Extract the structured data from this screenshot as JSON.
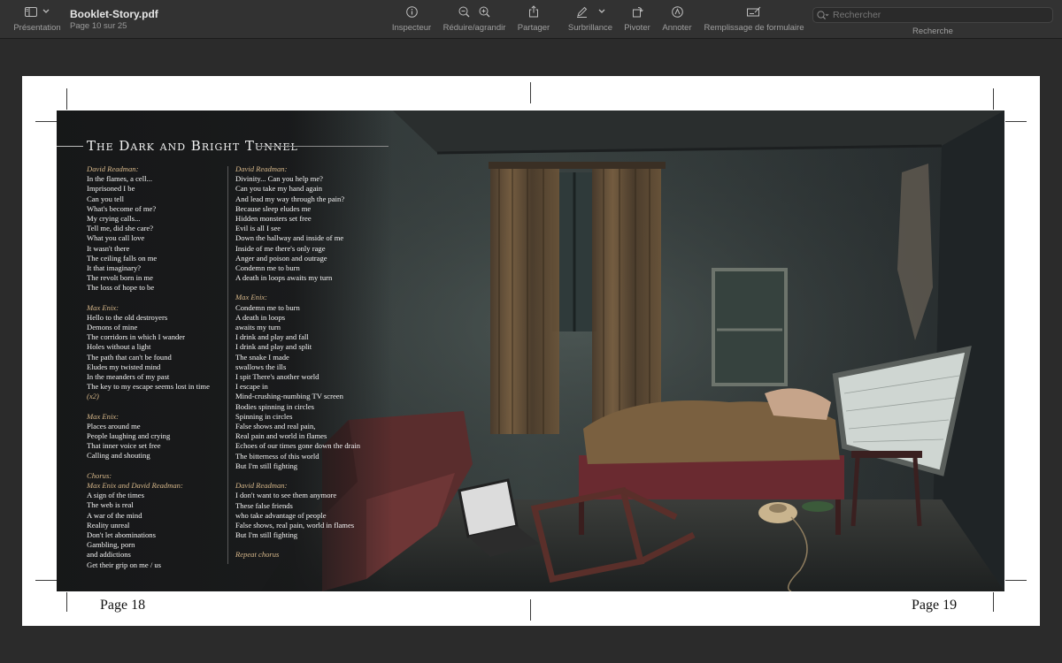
{
  "toolbar": {
    "view_label": "Présentation",
    "doc_title": "Booklet-Story.pdf",
    "doc_subtitle": "Page 10 sur 25",
    "inspector_label": "Inspecteur",
    "zoom_label": "Réduire/agrandir",
    "share_label": "Partager",
    "highlight_label": "Surbrillance",
    "rotate_label": "Pivoter",
    "annotate_label": "Annoter",
    "form_label": "Remplissage de formulaire",
    "search_placeholder": "Rechercher",
    "search_label": "Recherche"
  },
  "colors": {
    "accent_italic": "#d6b78a",
    "toolbar_bg": "#323232",
    "canvas_bg": "#2b2b2b"
  },
  "icons": [
    "sidebar-icon",
    "chevron-down-icon",
    "info-icon",
    "zoom-out-icon",
    "zoom-in-icon",
    "share-icon",
    "highlighter-icon",
    "rotate-icon",
    "annotate-icon",
    "form-fill-icon",
    "search-icon"
  ],
  "page": {
    "song_title": "The Dark and Bright Tunnel",
    "left_page": "Page 18",
    "right_page": "Page 19",
    "col1": [
      {
        "speaker": "David Readman:",
        "lines": [
          "In the flames, a cell...",
          "Imprisoned I be",
          "Can you tell",
          "What's become of me?",
          "My crying calls...",
          "Tell me, did she care?",
          "What you call love",
          "It wasn't there",
          "The ceiling falls on me",
          "It that imaginary?",
          "The revolt born in me",
          "The loss of hope to be"
        ]
      },
      {
        "speaker": "Max Enix:",
        "lines": [
          "Hello to the old destroyers",
          "Demons of mine",
          "The corridors in which I wander",
          "Holes without a light",
          "The path that can't be found",
          "Eludes my twisted mind",
          "In the meanders of my past",
          "The key to my escape seems lost in time"
        ],
        "extra": "(x2)"
      },
      {
        "speaker": "Max Enix:",
        "lines": [
          "Places around me",
          "People laughing and crying",
          "That inner voice set free",
          "Calling and shouting"
        ]
      },
      {
        "speaker": "Chorus:",
        "speaker2": "Max Enix and David Readman:",
        "lines": [
          "A sign of the times",
          "The web is real",
          "A war of the mind",
          "Reality unreal",
          "Don't let abominations",
          "Gambling, porn",
          "and addictions",
          "Get their grip on me / us"
        ]
      }
    ],
    "col2": [
      {
        "speaker": "David Readman:",
        "lines": [
          "Divinity... Can you help me?",
          "Can you take my hand again",
          "And lead my way through the pain?",
          "Because sleep eludes me",
          "Hidden monsters set free",
          "Evil is all I see",
          "Down the hallway and inside of me",
          "Inside of me there's only rage",
          "Anger and poison and outrage",
          "Condemn me to burn",
          "A death in loops awaits my turn"
        ]
      },
      {
        "speaker": "Max Enix:",
        "lines": [
          "Condemn me to burn",
          "A death in loops",
          "awaits my turn",
          "I drink and play and fall",
          "I drink and play and split",
          "The snake I made",
          "swallows the ills",
          "I spit There's another world",
          "I escape in",
          "Mind-crushing-numbing TV  screen",
          "Bodies spinning in circles",
          "Spinning in circles",
          "False shows and real pain,",
          "Real pain and world in flames",
          "Echoes of our times gone down the drain",
          "The bitterness of this world",
          "But I'm still fighting"
        ]
      },
      {
        "speaker": "David Readman:",
        "lines": [
          "I don't want to see them anymore",
          "These false friends",
          "who take advantage of people",
          "False shows, real pain, world in flames",
          "But I'm still fighting"
        ]
      },
      {
        "speaker": "Repeat chorus",
        "lines": []
      }
    ]
  }
}
